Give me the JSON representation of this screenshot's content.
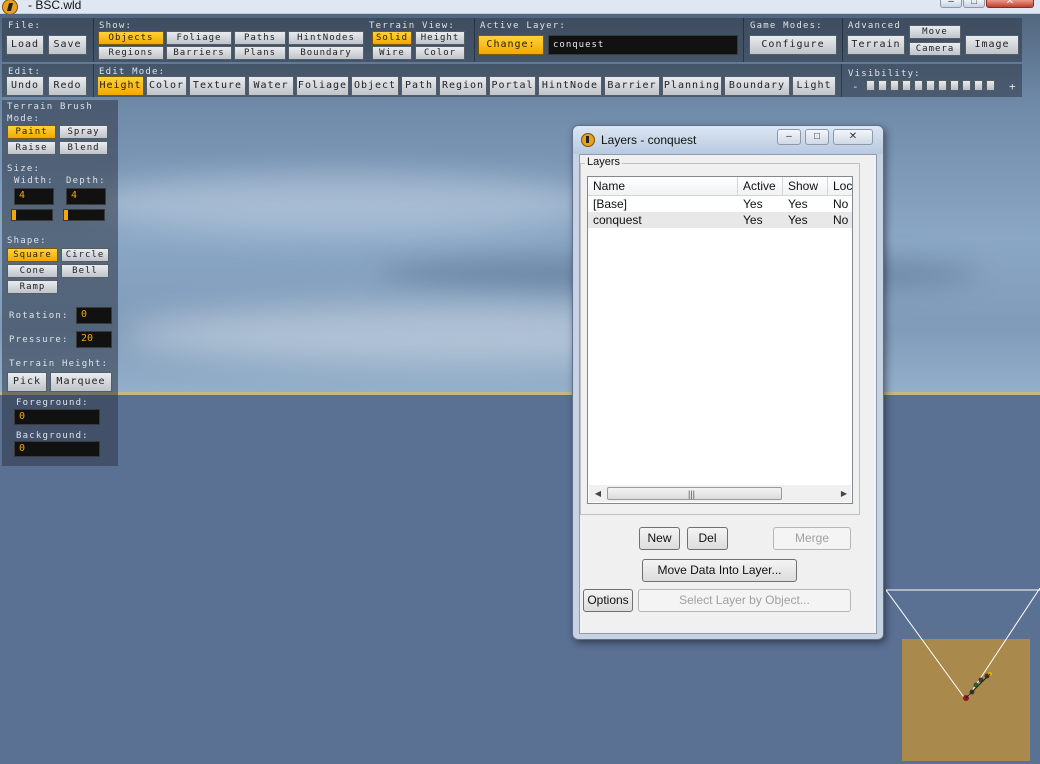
{
  "window": {
    "title": "- BSC.wld",
    "min_glyph": "–",
    "max_glyph": "□",
    "close_glyph": "✕"
  },
  "toolbar": {
    "file": {
      "label": "File:",
      "load": "Load",
      "save": "Save"
    },
    "show": {
      "label": "Show:",
      "items": [
        "Objects",
        "Foliage",
        "Paths",
        "HintNodes",
        "Regions",
        "Barriers",
        "Plans",
        "Boundary"
      ],
      "active": "Objects"
    },
    "terrain_view": {
      "label": "Terrain View:",
      "items": [
        "Solid",
        "Height",
        "Wire",
        "Color"
      ],
      "active": "Solid"
    },
    "active_layer": {
      "label": "Active Layer:",
      "change": "Change:",
      "value": "conquest"
    },
    "game_modes": {
      "label": "Game Modes:",
      "configure": "Configure"
    },
    "advanced": {
      "label": "Advanced",
      "move": "Move",
      "terrain": "Terrain",
      "camera": "Camera",
      "image": "Image"
    },
    "edit": {
      "label": "Edit:",
      "undo": "Undo",
      "redo": "Redo"
    },
    "edit_mode": {
      "label": "Edit Mode:",
      "items": [
        "Height",
        "Color",
        "Texture",
        "Water",
        "Foliage",
        "Object",
        "Path",
        "Region",
        "Portal",
        "HintNode",
        "Barrier",
        "Planning",
        "Boundary",
        "Light"
      ],
      "active": "Height"
    },
    "visibility": {
      "label": "Visibility:",
      "minus": "-",
      "plus": "+"
    }
  },
  "terrain_brush": {
    "title": "Terrain Brush",
    "mode_label": "Mode:",
    "modes": [
      "Paint",
      "Spray",
      "Raise",
      "Blend"
    ],
    "active_mode": "Paint",
    "size_label": "Size:",
    "width_label": "Width:",
    "depth_label": "Depth:",
    "width": "4",
    "depth": "4",
    "shape_label": "Shape:",
    "shapes": [
      "Square",
      "Circle",
      "Cone",
      "Bell",
      "Ramp"
    ],
    "active_shape": "Square",
    "rotation_label": "Rotation:",
    "rotation": "0",
    "pressure_label": "Pressure:",
    "pressure": "20",
    "terrain_height_label": "Terrain Height:",
    "pick": "Pick",
    "marquee": "Marquee",
    "foreground_label": "Foreground:",
    "foreground": "0",
    "background_label": "Background:",
    "background": "0"
  },
  "layers_dialog": {
    "title": "Layers - conquest",
    "group_label": "Layers",
    "columns": [
      "Name",
      "Active",
      "Show",
      "Loc"
    ],
    "rows": [
      {
        "name": "[Base]",
        "active": "Yes",
        "show": "Yes",
        "loc": "No"
      },
      {
        "name": "conquest",
        "active": "Yes",
        "show": "Yes",
        "loc": "No"
      }
    ],
    "buttons": {
      "new": "New",
      "del": "Del",
      "merge": "Merge",
      "move_data": "Move Data Into Layer...",
      "options": "Options",
      "select_by_object": "Select Layer by Object..."
    },
    "scroll_grip": "|||"
  }
}
